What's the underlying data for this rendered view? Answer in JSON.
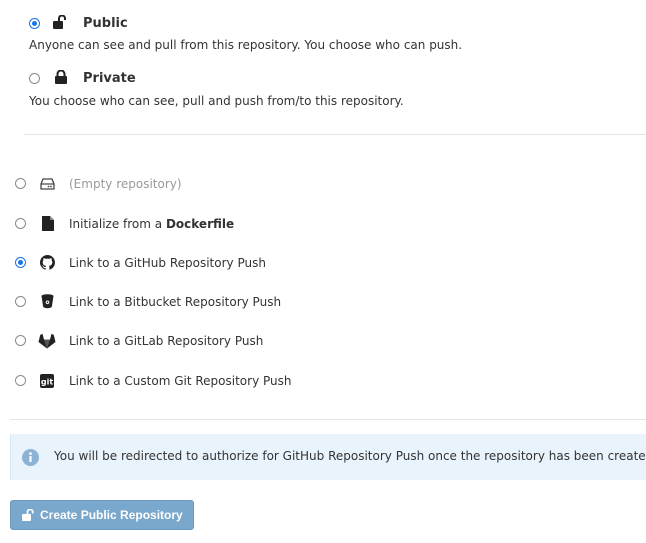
{
  "visibility": {
    "public": {
      "label": "Public",
      "description": "Anyone can see and pull from this repository. You choose who can push.",
      "selected": true,
      "icon": "unlock-icon"
    },
    "private": {
      "label": "Private",
      "description": "You choose who can see, pull and push from/to this repository.",
      "selected": false,
      "icon": "lock-icon"
    }
  },
  "init_options": [
    {
      "label": "(Empty repository)",
      "icon": "hard-drive-icon",
      "selected": false
    },
    {
      "label_prefix": "Initialize from a ",
      "label_bold": "Dockerfile",
      "icon": "file-icon",
      "selected": false
    },
    {
      "label": "Link to a GitHub Repository Push",
      "icon": "github-icon",
      "selected": true
    },
    {
      "label": "Link to a Bitbucket Repository Push",
      "icon": "bitbucket-icon",
      "selected": false
    },
    {
      "label": "Link to a GitLab Repository Push",
      "icon": "gitlab-icon",
      "selected": false
    },
    {
      "label": "Link to a Custom Git Repository Push",
      "icon": "git-icon",
      "selected": false
    }
  ],
  "info": {
    "message": "You will be redirected to authorize for GitHub Repository Push once the repository has been created",
    "icon": "info-icon"
  },
  "create_button": {
    "label": "Create Public Repository",
    "icon": "unlock-icon"
  },
  "colors": {
    "radio_selected": "#1a73e8",
    "info_background": "#e8f3fb",
    "info_icon": "#8db3d4",
    "button_background": "#7aa7cc"
  }
}
